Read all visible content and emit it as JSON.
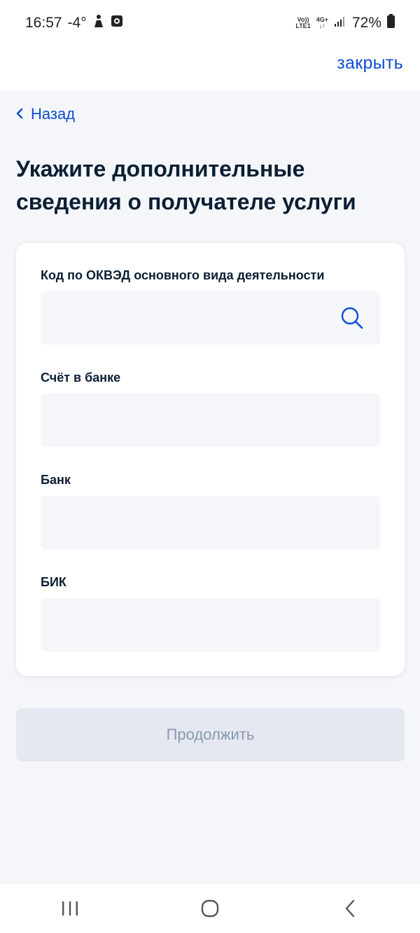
{
  "status_bar": {
    "time": "16:57",
    "temperature": "-4°",
    "net_top": "Vo))",
    "net_bottom": "LTE1",
    "net_type": "4G+",
    "battery": "72%"
  },
  "header": {
    "close_label": "закрыть",
    "back_label": "Назад"
  },
  "page": {
    "title": "Укажите дополнительные сведения о получателе услуги"
  },
  "form": {
    "okved_label": "Код по ОКВЭД основного вида деятельности",
    "okved_value": "",
    "account_label": "Счёт в банке",
    "account_value": "",
    "bank_label": "Банк",
    "bank_value": "",
    "bik_label": "БИК",
    "bik_value": ""
  },
  "actions": {
    "continue_label": "Продолжить"
  },
  "icons": {
    "search": "search-icon",
    "back": "chevron-left-icon",
    "nav_recents": "recents-icon",
    "nav_home": "home-icon",
    "nav_back": "back-icon"
  },
  "colors": {
    "accent": "#0d4cd3",
    "page_bg": "#f4f6fa",
    "title": "#0b1f33",
    "disabled_button_bg": "#e5e8f1",
    "disabled_button_text": "#8a9aac"
  }
}
